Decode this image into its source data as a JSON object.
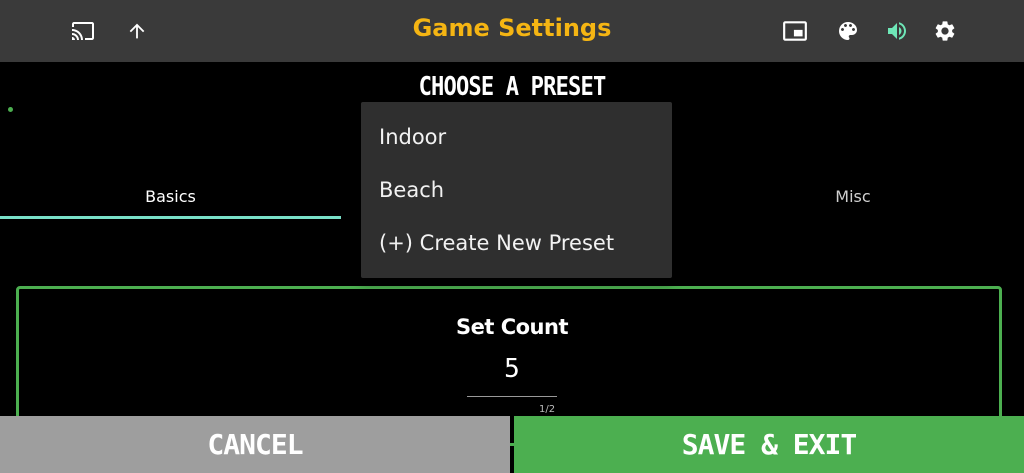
{
  "header": {
    "title": "Game Settings",
    "icons": {
      "left": [
        "cast-icon",
        "arrow-up-icon"
      ],
      "right": [
        "picture-in-picture-icon",
        "palette-icon",
        "volume-icon",
        "gear-icon"
      ]
    },
    "colors": {
      "title": "#f5b513",
      "bar": "#3a3a3a",
      "volume": "#6ee7b7"
    }
  },
  "preset": {
    "heading": "CHOOSE A PRESET"
  },
  "tabs": [
    {
      "label": "Basics",
      "active": true
    },
    {
      "label": "Misc",
      "active": false
    }
  ],
  "dropdown": {
    "items": [
      "Indoor",
      "Beach",
      "(+) Create New Preset"
    ]
  },
  "settings": {
    "set_count": {
      "label": "Set Count",
      "value": "5",
      "counter": "1/2"
    }
  },
  "buttons": {
    "cancel": "CANCEL",
    "save": "SAVE & EXIT"
  },
  "colors": {
    "accent_green": "#4caf50",
    "tab_underline": "#79e0c8",
    "cancel_gray": "#9e9e9e"
  }
}
